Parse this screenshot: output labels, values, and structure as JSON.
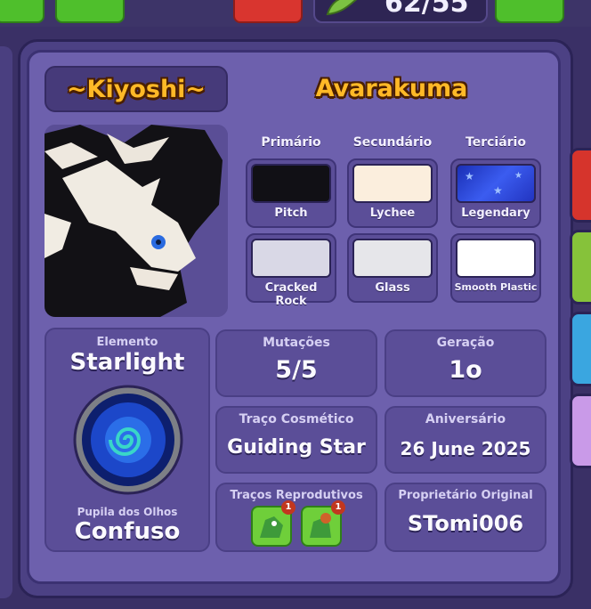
{
  "top_bar": {
    "counter_text": "62/55"
  },
  "pet": {
    "name": "~Kiyoshi~",
    "species": "Avarakuma"
  },
  "colors": {
    "headers": [
      "Primário",
      "Secundário",
      "Terciário"
    ],
    "swatches": [
      {
        "label": "Pitch",
        "color": "#111015"
      },
      {
        "label": "Lychee",
        "color": "#fbeedd"
      },
      {
        "label": "Legendary",
        "color": "#2b47d8"
      },
      {
        "label": "Cracked Rock",
        "color": "#d9d8e6"
      },
      {
        "label": "Glass",
        "color": "#e6e6ea"
      },
      {
        "label": "Smooth Plastic",
        "color": "#ffffff"
      }
    ]
  },
  "element": {
    "title": "Elemento",
    "value": "Starlight"
  },
  "pupil": {
    "title": "Pupila dos Olhos",
    "value": "Confuso"
  },
  "mutations": {
    "title": "Mutações",
    "value": "5/5"
  },
  "generation": {
    "title": "Geração",
    "value": "1o"
  },
  "cosmetic": {
    "title": "Traço Cosmético",
    "value": "Guiding Star"
  },
  "birthday": {
    "title": "Aniversário",
    "value": "26 June 2025"
  },
  "breeding": {
    "title": "Traços Reprodutivos",
    "badges": [
      "1",
      "1"
    ]
  },
  "owner": {
    "title": "Proprietário Original",
    "value": "STomi006"
  }
}
